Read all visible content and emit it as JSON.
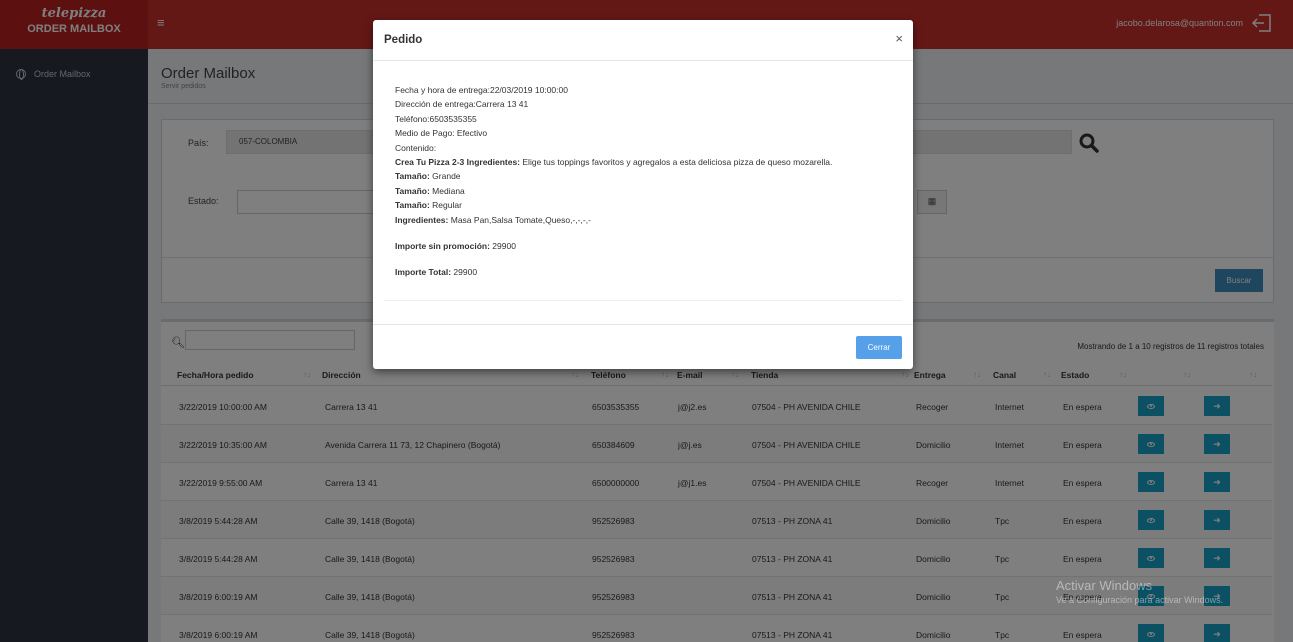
{
  "app": {
    "brand_logo": "telepizza",
    "brand_title": "ORDER MAILBOX",
    "menu_icon": "hamburger-icon",
    "user_email": "jacobo.delarosa@quantion.com",
    "logout_icon": "logout-icon"
  },
  "sidebar": {
    "items": [
      {
        "label": "Order Mailbox",
        "icon": "globe-icon"
      }
    ]
  },
  "page": {
    "title": "Order Mailbox",
    "subtitle": "Servir pedidos"
  },
  "filters": {
    "pais_label": "País:",
    "pais_value": "057-COLOMBIA",
    "estado_label": "Estado:",
    "buscar_label": "Buscar"
  },
  "table": {
    "info": "Mostrando de 1 a 10 registros de 11 registros totales",
    "columns": [
      "Fecha/Hora pedido",
      "Dirección",
      "Teléfono",
      "E-mail",
      "Tienda",
      "Entrega",
      "Canal",
      "Estado"
    ],
    "rows": [
      {
        "fecha": "3/22/2019 10:00:00 AM",
        "direccion": "Carrera 13 41",
        "telefono": "6503535355",
        "email": "j@j2.es",
        "tienda": "07504 - PH AVENIDA CHILE",
        "entrega": "Recoger",
        "canal": "Internet",
        "estado": "En espera"
      },
      {
        "fecha": "3/22/2019 10:35:00 AM",
        "direccion": "Avenida Carrera 11 73, 12 Chapinero (Bogotá)",
        "telefono": "650384609",
        "email": "j@j.es",
        "tienda": "07504 - PH AVENIDA CHILE",
        "entrega": "Domicilio",
        "canal": "Internet",
        "estado": "En espera"
      },
      {
        "fecha": "3/22/2019 9:55:00 AM",
        "direccion": "Carrera 13 41",
        "telefono": "6500000000",
        "email": "j@j1.es",
        "tienda": "07504 - PH AVENIDA CHILE",
        "entrega": "Recoger",
        "canal": "Internet",
        "estado": "En espera"
      },
      {
        "fecha": "3/8/2019 5:44:28 AM",
        "direccion": "Calle 39, 1418 (Bogotá)",
        "telefono": "952526983",
        "email": "",
        "tienda": "07513 - PH ZONA 41",
        "entrega": "Domicilio",
        "canal": "Tpc",
        "estado": "En espera"
      },
      {
        "fecha": "3/8/2019 5:44:28 AM",
        "direccion": "Calle 39, 1418 (Bogotá)",
        "telefono": "952526983",
        "email": "",
        "tienda": "07513 - PH ZONA 41",
        "entrega": "Domicilio",
        "canal": "Tpc",
        "estado": "En espera"
      },
      {
        "fecha": "3/8/2019 6:00:19 AM",
        "direccion": "Calle 39, 1418 (Bogotá)",
        "telefono": "952526983",
        "email": "",
        "tienda": "07513 - PH ZONA 41",
        "entrega": "Domicilio",
        "canal": "Tpc",
        "estado": "En espera"
      },
      {
        "fecha": "3/8/2019 6:00:19 AM",
        "direccion": "Calle 39, 1418 (Bogotá)",
        "telefono": "952526983",
        "email": "",
        "tienda": "07513 - PH ZONA 41",
        "entrega": "Domicilio",
        "canal": "Tpc",
        "estado": "En espera"
      }
    ]
  },
  "modal": {
    "title": "Pedido",
    "close": "×",
    "fecha_entrega": "Fecha y hora de entrega:22/03/2019 10:00:00",
    "direccion_entrega": "Dirección de entrega:Carrera 13 41",
    "telefono": "Teléfono:6503535355",
    "medio_pago": "Medio de Pago: Efectivo",
    "contenido": "Contenido:",
    "producto_label": "Crea Tu Pizza 2-3 Ingredientes:",
    "producto_desc": "Elige tus toppings favoritos y agregalos a esta deliciosa pizza de queso mozarella.",
    "tamano_label": "Tamaño:",
    "tamano_1": "Grande",
    "tamano_2": "Mediana",
    "tamano_3": "Regular",
    "ingredientes_label": "Ingredientes:",
    "ingredientes_value": "Masa Pan,Salsa Tomate,Queso,-,-,-,-",
    "importe_sin_label": "Importe sin promoción:",
    "importe_sin_value": "29900",
    "importe_total_label": "Importe Total:",
    "importe_total_value": "29900",
    "cerrar_label": "Cerrar"
  },
  "watermark": {
    "title": "Activar Windows",
    "subtitle": "Ve a Configuración para activar Windows."
  }
}
